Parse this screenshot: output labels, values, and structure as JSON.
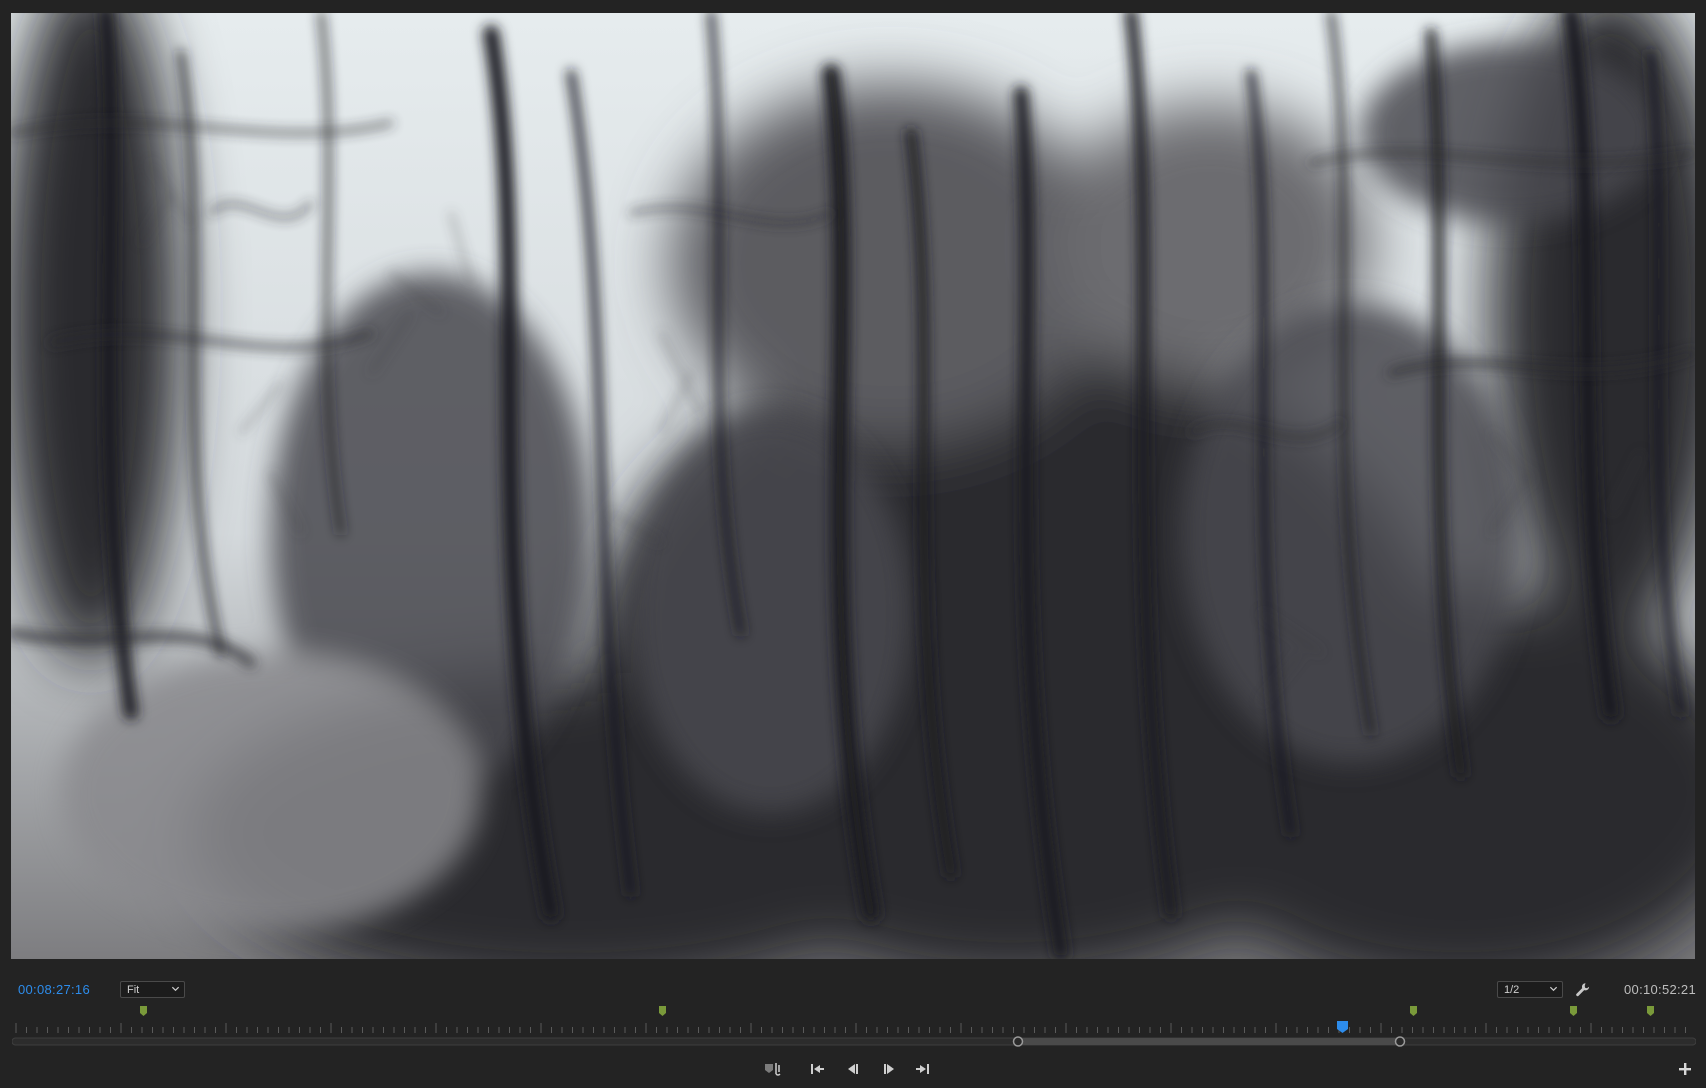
{
  "monitor": {
    "current_timecode": "00:08:27:16",
    "duration_timecode": "00:10:52:21",
    "zoom_level": "Fit",
    "playback_resolution": "1/2"
  },
  "icons": {
    "zoom_dropdown": "chevron-down-icon",
    "resolution_dropdown": "chevron-down-icon",
    "settings": "wrench-icon",
    "add_marker": "marker-icon",
    "go_to_in": "step-to-in-icon",
    "step_back": "step-back-icon",
    "step_forward": "step-forward-icon",
    "go_to_out": "step-to-out-icon",
    "button_editor": "plus-icon"
  },
  "colors": {
    "accent": "#2d8ceb",
    "marker": "#7a9a3a",
    "background": "#232323"
  }
}
